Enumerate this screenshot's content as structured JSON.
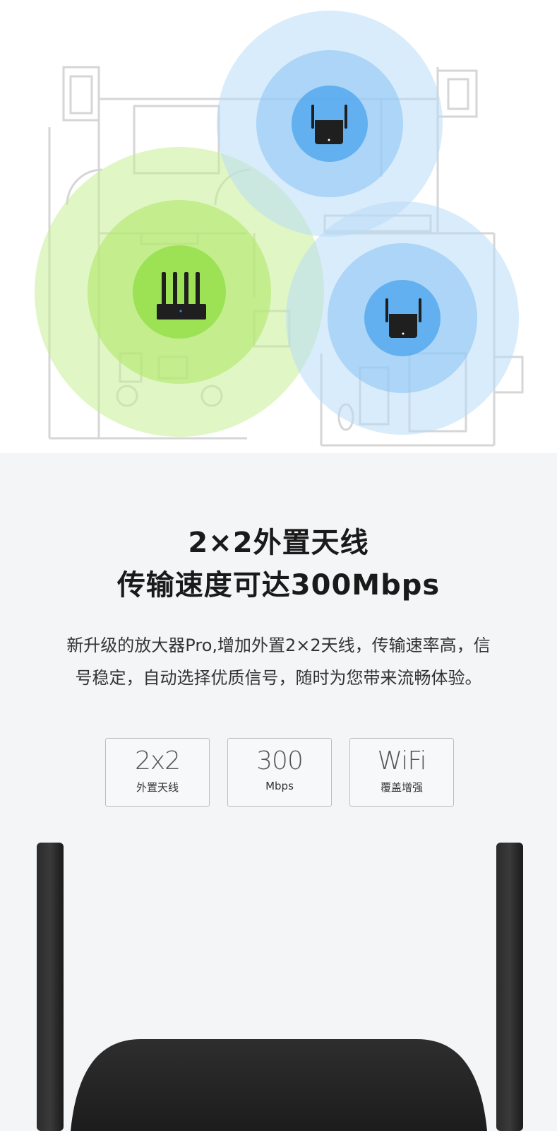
{
  "hero": {
    "devices": [
      {
        "name": "router-icon",
        "ring_color": "#b9ec7a"
      },
      {
        "name": "repeater-icon",
        "ring_color": "#8cc6f6"
      },
      {
        "name": "repeater-icon",
        "ring_color": "#8cc6f6"
      }
    ]
  },
  "headline": {
    "line1": "2×2外置天线",
    "line2": "传输速度可达300Mbps"
  },
  "description": {
    "line1": "新升级的放大器Pro,增加外置2×2天线，传输速率高，信",
    "line2": "号稳定，自动选择优质信号，随时为您带来流畅体验。"
  },
  "features": [
    {
      "big": "2x2",
      "small": "外置天线"
    },
    {
      "big": "300",
      "small": "Mbps"
    },
    {
      "big": "WiFi",
      "small": "覆盖增强"
    }
  ],
  "colors": {
    "background": "#f4f5f7",
    "green_signal": "#b9ec7a",
    "blue_signal": "#8cc6f6",
    "device_body": "#1f1f1f"
  }
}
